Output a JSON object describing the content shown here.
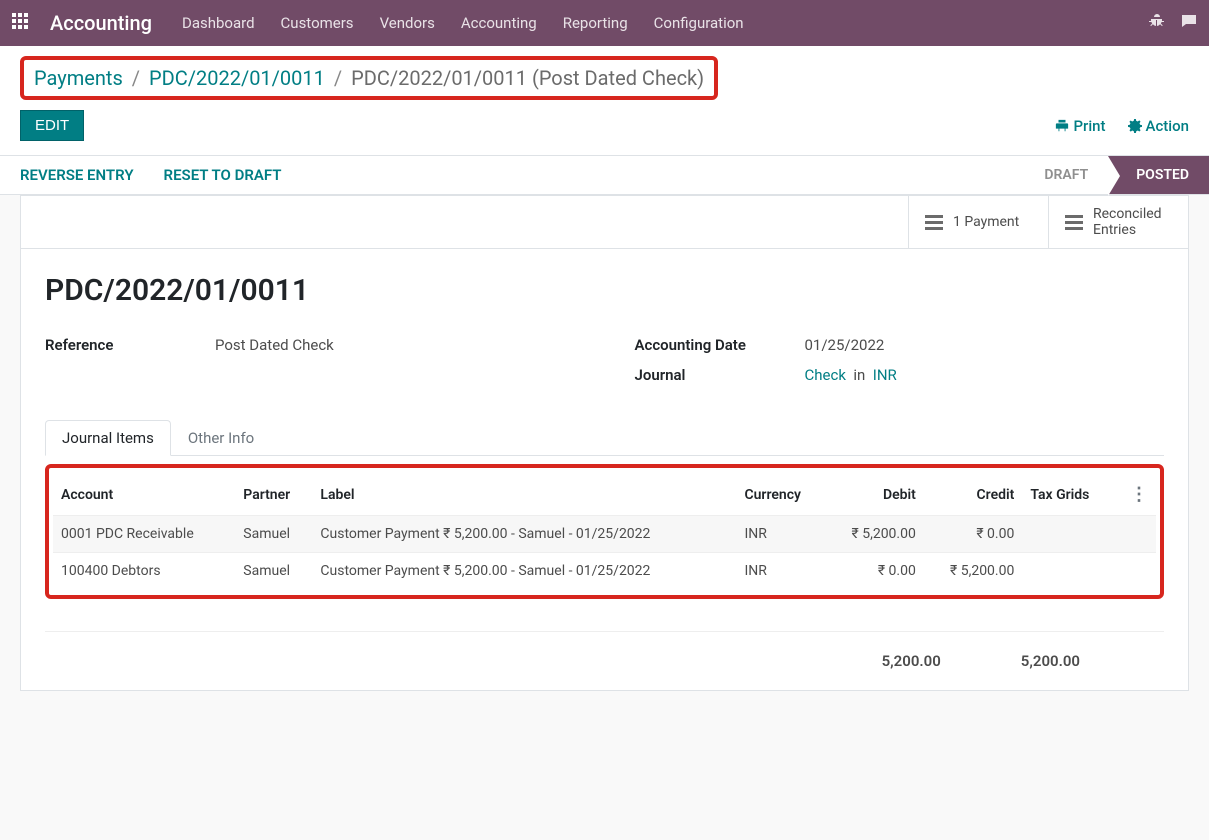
{
  "topbar": {
    "app": "Accounting",
    "nav": [
      "Dashboard",
      "Customers",
      "Vendors",
      "Accounting",
      "Reporting",
      "Configuration"
    ]
  },
  "breadcrumb": {
    "l1": "Payments",
    "l2": "PDC/2022/01/0011",
    "l3": "PDC/2022/01/0011 (Post Dated Check)"
  },
  "buttons": {
    "edit": "EDIT",
    "print": "Print",
    "action": "Action",
    "reverse": "REVERSE ENTRY",
    "reset": "RESET TO DRAFT"
  },
  "status": {
    "draft": "DRAFT",
    "posted": "POSTED"
  },
  "stats": {
    "payment": "1 Payment",
    "reconciled1": "Reconciled",
    "reconciled2": "Entries"
  },
  "record": {
    "title": "PDC/2022/01/0011",
    "reference_label": "Reference",
    "reference": "Post Dated Check",
    "date_label": "Accounting Date",
    "date": "01/25/2022",
    "journal_label": "Journal",
    "journal_link": "Check",
    "journal_in": "in",
    "journal_curr": "INR"
  },
  "tabs": {
    "items": "Journal Items",
    "other": "Other Info"
  },
  "table": {
    "headers": {
      "account": "Account",
      "partner": "Partner",
      "label": "Label",
      "currency": "Currency",
      "debit": "Debit",
      "credit": "Credit",
      "taxgrids": "Tax Grids"
    },
    "rows": [
      {
        "account": "0001 PDC Receivable",
        "partner": "Samuel",
        "label": "Customer Payment ₹ 5,200.00 - Samuel - 01/25/2022",
        "currency": "INR",
        "debit": "₹ 5,200.00",
        "credit": "₹ 0.00"
      },
      {
        "account": "100400 Debtors",
        "partner": "Samuel",
        "label": "Customer Payment ₹ 5,200.00 - Samuel - 01/25/2022",
        "currency": "INR",
        "debit": "₹ 0.00",
        "credit": "₹ 5,200.00"
      }
    ],
    "total_debit": "5,200.00",
    "total_credit": "5,200.00"
  }
}
